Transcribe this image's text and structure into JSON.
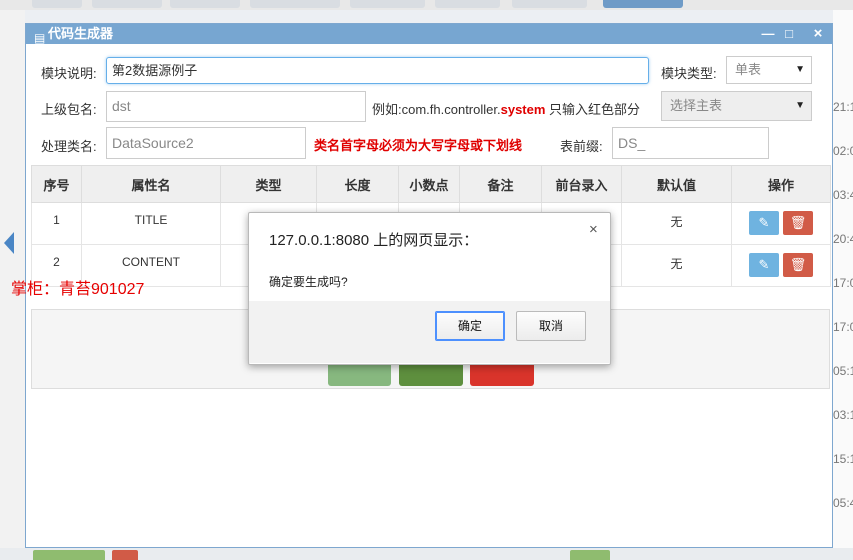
{
  "window": {
    "title": "代码生成器",
    "min_icon": "—",
    "max_icon": "□",
    "close_icon": "×"
  },
  "form": {
    "module_desc_label": "模块说明:",
    "module_desc_value": "第2数据源例子",
    "module_type_label": "模块类型:",
    "module_type_value": "单表",
    "package_label": "上级包名:",
    "package_value": "dst",
    "package_hint_prefix": "例如:com.fh.controller.",
    "package_hint_red": "system",
    "package_hint_suffix": "只输入红色部分",
    "master_table_value": "选择主表",
    "class_label": "处理类名:",
    "class_value": "DataSource2",
    "class_rule": "类名首字母必须为大写字母或下划线",
    "table_prefix_label": "表前缀:",
    "table_prefix_value": "DS_"
  },
  "table": {
    "headers": [
      "序号",
      "属性名",
      "类型",
      "长度",
      "小数点",
      "备注",
      "前台录入",
      "默认值",
      "操作"
    ],
    "rows": [
      {
        "no": "1",
        "name": "TITLE",
        "default": "无"
      },
      {
        "no": "2",
        "name": "CONTENT",
        "default": "无"
      }
    ]
  },
  "watermark": "掌柜：青苔901027",
  "right_edge": [
    "21:1",
    "02:0",
    "03:4",
    "20:4",
    "17:0",
    "17:0",
    "05:1",
    "03:1",
    "15:1",
    "05:4"
  ],
  "dialog": {
    "title": "127.0.0.1:8080 上的网页显示：",
    "message": "确定要生成吗?",
    "ok": "确定",
    "cancel": "取消",
    "close_icon": "×"
  },
  "colors": {
    "title_bar": "#77a6d1",
    "edit_button": "#6fb3e0",
    "delete_button": "#d15b47",
    "accent_red": "#e00000"
  }
}
